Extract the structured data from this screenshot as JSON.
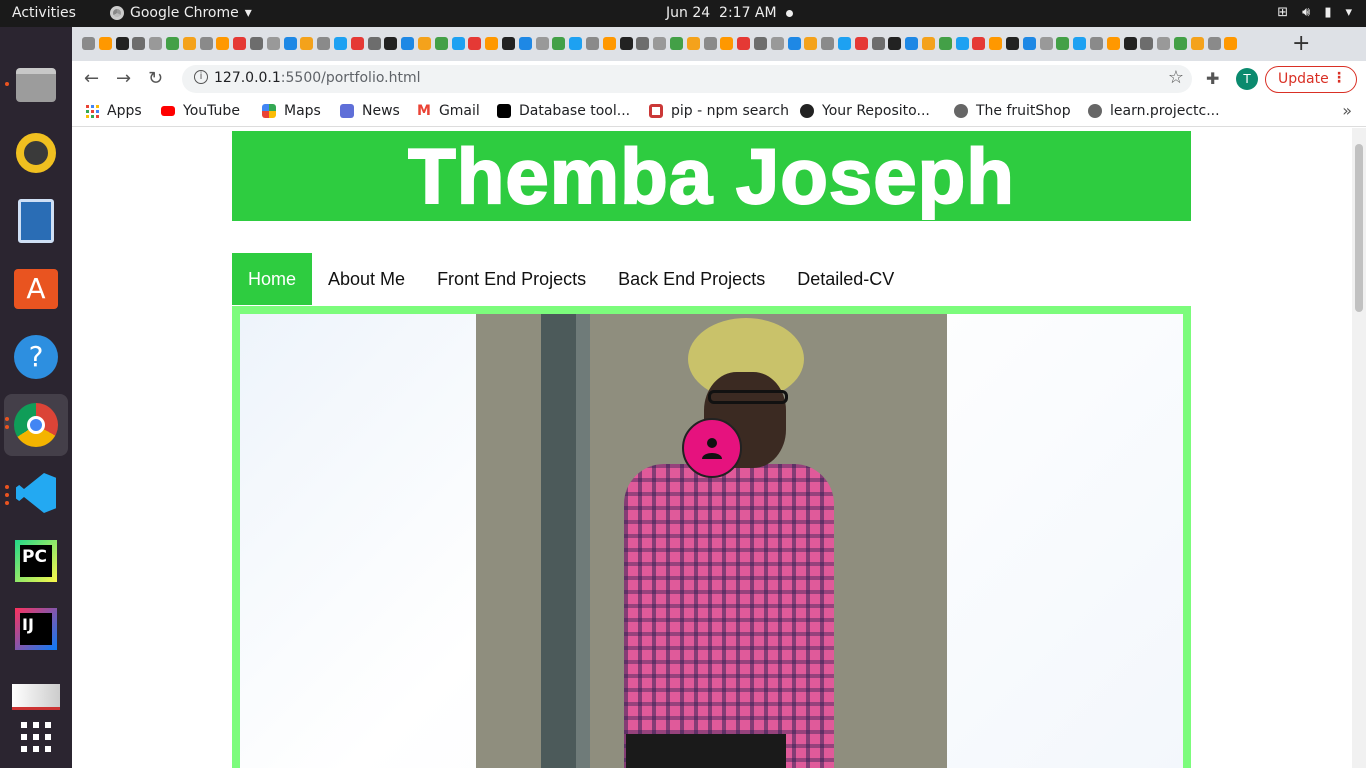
{
  "topbar": {
    "activities": "Activities",
    "app_name": "Google Chrome",
    "date": "Jun 24",
    "time": "2:17 AM"
  },
  "dock": {
    "items": [
      "files-icon",
      "rhythmbox-icon",
      "writer-icon",
      "software-icon",
      "help-icon",
      "chrome-icon",
      "vscode-icon",
      "pycharm-icon",
      "intellij-icon",
      "screenshot-icon",
      "show-apps-icon"
    ]
  },
  "browser": {
    "url_host": "127.0.0.1",
    "url_rest": ":5500/portfolio.html",
    "profile_initial": "T",
    "update_label": "Update",
    "bookmarks": [
      {
        "label": "Apps"
      },
      {
        "label": "YouTube"
      },
      {
        "label": "Maps"
      },
      {
        "label": "News"
      },
      {
        "label": "Gmail"
      },
      {
        "label": "Database tool..."
      },
      {
        "label": "pip - npm search"
      },
      {
        "label": "Your Reposito..."
      },
      {
        "label": "The fruitShop"
      },
      {
        "label": "learn.projectc..."
      }
    ]
  },
  "page": {
    "banner_title": "Themba Joseph",
    "nav": [
      {
        "label": "Home",
        "active": true
      },
      {
        "label": "About Me"
      },
      {
        "label": "Front End Projects"
      },
      {
        "label": "Back End Projects"
      },
      {
        "label": "Detailed-CV"
      }
    ]
  },
  "colors": {
    "brand_green": "#2ecc40",
    "hero_border": "#7cfc7c",
    "avatar_pink": "#e6127e",
    "update_red": "#d93025"
  }
}
